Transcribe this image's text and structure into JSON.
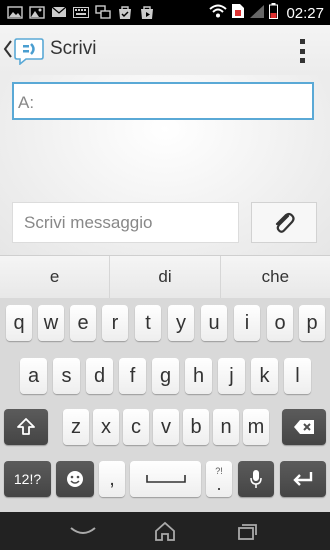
{
  "status_bar": {
    "time": "02:27",
    "icons": [
      "image-icon",
      "picture-icon",
      "mail-icon",
      "keyboard-icon",
      "windows-icon",
      "bag-icon",
      "play-store-icon",
      "wifi-icon",
      "sim-alert-icon",
      "signal-icon",
      "battery-icon"
    ]
  },
  "action_bar": {
    "title": "Scrivi"
  },
  "compose": {
    "to_placeholder": "A:",
    "message_placeholder": "Scrivi messaggio"
  },
  "suggestions": [
    "e",
    "di",
    "che"
  ],
  "keyboard": {
    "row1": [
      "q",
      "w",
      "e",
      "r",
      "t",
      "y",
      "u",
      "i",
      "o",
      "p"
    ],
    "row2": [
      "a",
      "s",
      "d",
      "f",
      "g",
      "h",
      "j",
      "k",
      "l"
    ],
    "row3": [
      "z",
      "x",
      "c",
      "v",
      "b",
      "n",
      "m"
    ],
    "symbols_label": "12!?",
    "comma_label": ",",
    "period_label": ".",
    "period_hint": "?!"
  },
  "colors": {
    "focus_border": "#5aa9d6",
    "dark_key": "#4f4f4f",
    "nav_bar": "#222222"
  }
}
